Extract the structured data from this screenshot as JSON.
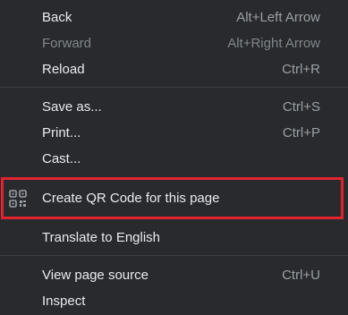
{
  "menu": {
    "items": [
      {
        "label": "Back",
        "shortcut": "Alt+Left Arrow"
      },
      {
        "label": "Forward",
        "shortcut": "Alt+Right Arrow"
      },
      {
        "label": "Reload",
        "shortcut": "Ctrl+R"
      },
      {
        "label": "Save as...",
        "shortcut": "Ctrl+S"
      },
      {
        "label": "Print...",
        "shortcut": "Ctrl+P"
      },
      {
        "label": "Cast..."
      },
      {
        "label": "Create QR Code for this page",
        "icon": "qr-code-icon"
      },
      {
        "label": "Translate to English"
      },
      {
        "label": "View page source",
        "shortcut": "Ctrl+U"
      },
      {
        "label": "Inspect"
      }
    ]
  },
  "colors": {
    "background": "#292a2d",
    "text": "#e8eaed",
    "disabled_text": "#80868b",
    "shortcut_text": "#9aa0a6",
    "separator": "#3c4043",
    "highlight_border": "#e0242f"
  }
}
